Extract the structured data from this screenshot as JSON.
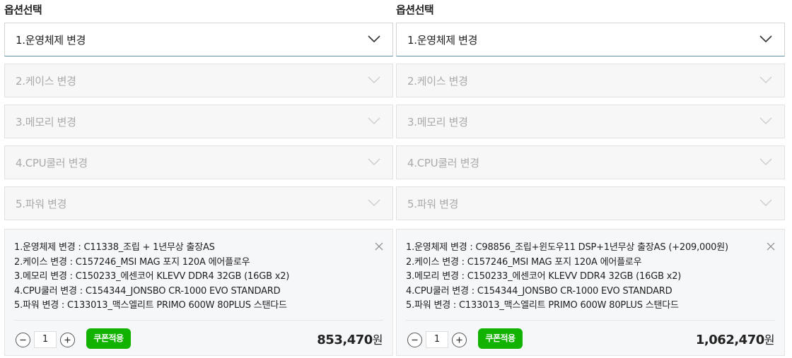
{
  "left": {
    "option_title": "옵션선택",
    "selects": [
      {
        "label": "1.운영체제 변경"
      },
      {
        "label": "2.케이스 변경"
      },
      {
        "label": "3.메모리 변경"
      },
      {
        "label": "4.CPU쿨러 변경"
      },
      {
        "label": "5.파워 변경"
      }
    ],
    "summary": {
      "lines": [
        "1.운영체제 변경 : C11338_조립 + 1년무상 출장AS",
        "2.케이스 변경 : C157246_MSI MAG 포지 120A 에어플로우",
        "3.메모리 변경 : C150233_에센코어 KLEVV DDR4 32GB (16GB x2)",
        "4.CPU쿨러 변경 : C154344_JONSBO CR-1000 EVO STANDARD",
        "5.파워 변경 : C133013_맥스엘리트 PRIMO 600W 80PLUS 스탠다드"
      ],
      "quantity": "1",
      "coupon_label": "쿠폰적용",
      "price": "853,470",
      "currency": "원"
    }
  },
  "right": {
    "option_title": "옵션선택",
    "selects": [
      {
        "label": "1.운영체제 변경"
      },
      {
        "label": "2.케이스 변경"
      },
      {
        "label": "3.메모리 변경"
      },
      {
        "label": "4.CPU쿨러 변경"
      },
      {
        "label": "5.파워 변경"
      }
    ],
    "summary": {
      "lines": [
        "1.운영체제 변경 : C98856_조립+윈도우11 DSP+1년무상 출장AS (+209,000원)",
        "2.케이스 변경 : C157246_MSI MAG 포지 120A 에어플로우",
        "3.메모리 변경 : C150233_에센코어 KLEVV DDR4 32GB (16GB x2)",
        "4.CPU쿨러 변경 : C154344_JONSBO CR-1000 EVO STANDARD",
        "5.파워 변경 : C133013_맥스엘리트 PRIMO 600W 80PLUS 스탠다드"
      ],
      "quantity": "1",
      "coupon_label": "쿠폰적용",
      "price": "1,062,470",
      "currency": "원"
    }
  },
  "colors": {
    "coupon_green": "#11b300",
    "active_border": "#5f8fa3",
    "disabled_text": "#aaaaaa"
  },
  "icons": {
    "dropdown": "chevron-down-icon",
    "close": "close-icon",
    "minus": "minus-icon",
    "plus": "plus-icon"
  }
}
